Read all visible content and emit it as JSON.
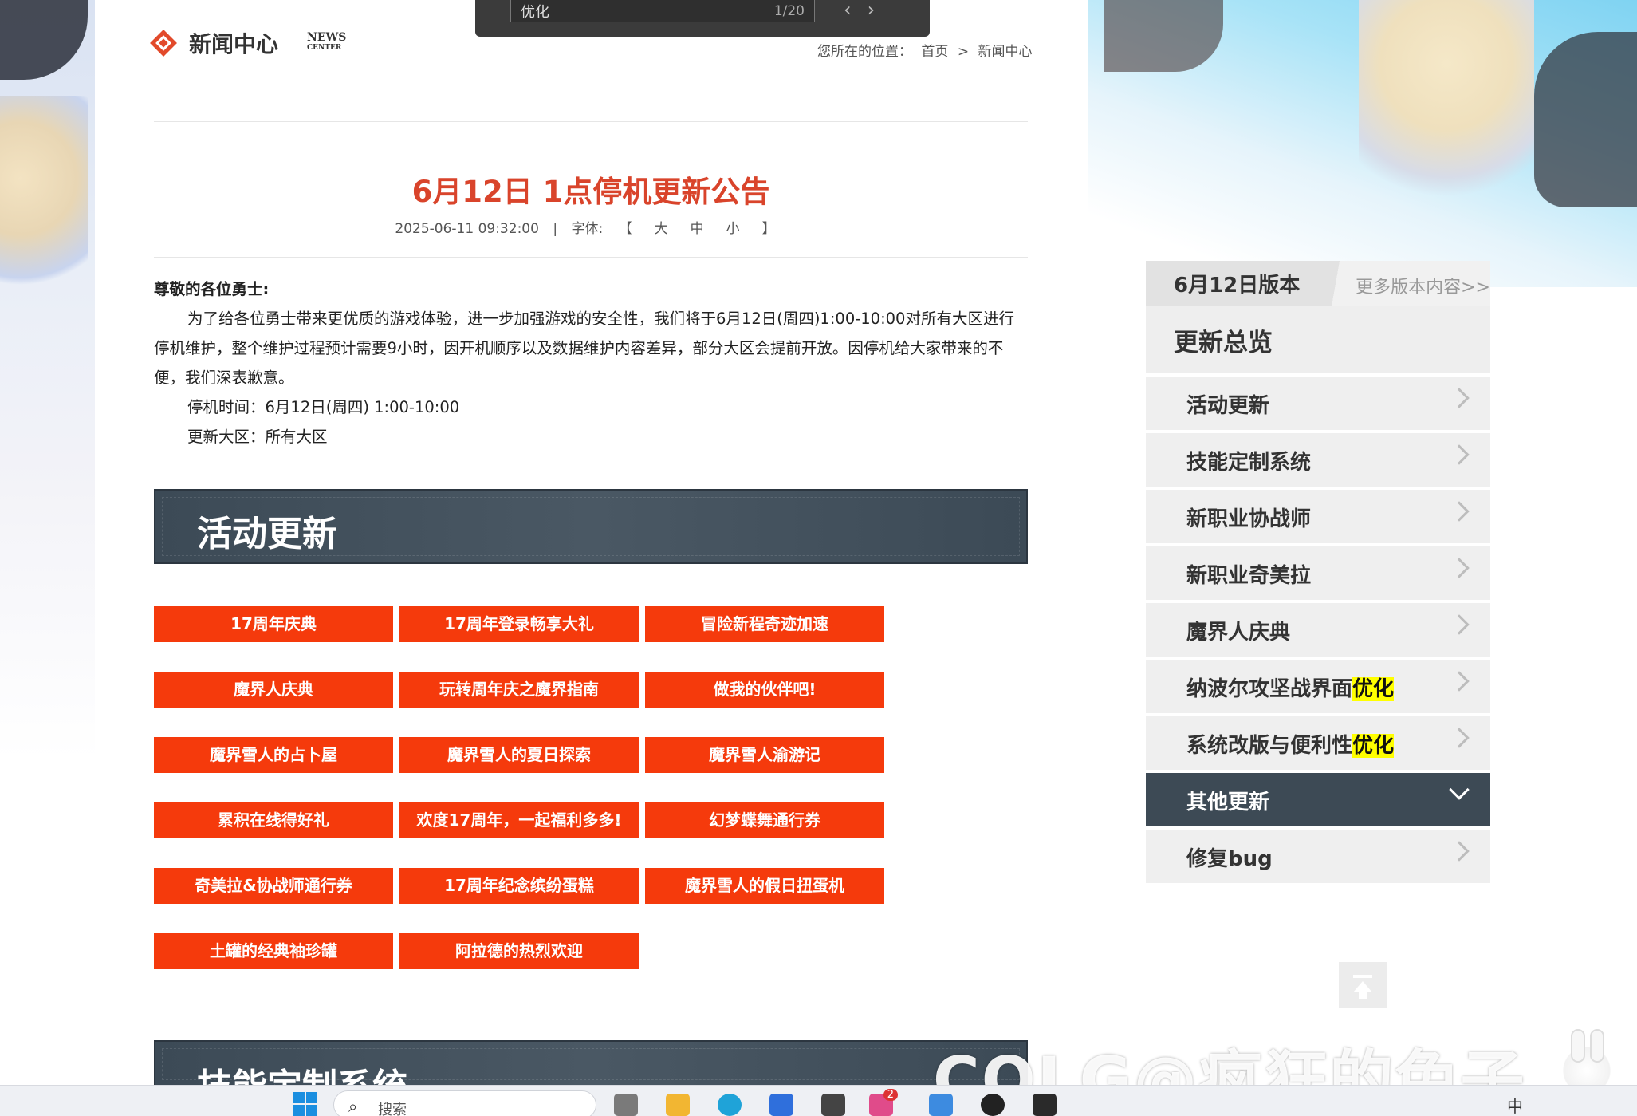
{
  "findbar": {
    "query": "优化",
    "count": "1/20",
    "prev": "‹",
    "next": "›"
  },
  "header": {
    "logo_text": "新闻中心",
    "logo_en_line1": "NEWS",
    "logo_en_line2": "CENTER",
    "breadcrumb_prefix": "您所在的位置：",
    "breadcrumb_home": "首页",
    "breadcrumb_sep": ">",
    "breadcrumb_current": "新闻中心"
  },
  "article": {
    "title": "6月12日 1点停机更新公告",
    "datetime": "2025-06-11 09:32:00",
    "meta_sep": "|",
    "font_label": "字体:",
    "font_open": "【",
    "font_large": "大",
    "font_medium": "中",
    "font_small": "小",
    "font_close": "】",
    "greeting": "尊敬的各位勇士:",
    "para1": "为了给各位勇士带来更优质的游戏体验，进一步加强游戏的安全性，我们将于6月12日(周四)1:00-10:00对所有大区进行停机维护，整个维护过程预计需要9小时，因开机顺序以及数据维护内容差异，部分大区会提前开放。因停机给大家带来的不便，我们深表歉意。",
    "downtime": "停机时间：6月12日(周四) 1:00-10:00",
    "regions": "更新大区：所有大区"
  },
  "sections": {
    "activity_title": "活动更新",
    "skill_title": "技能定制系统"
  },
  "activity_buttons": [
    "17周年庆典",
    "17周年登录畅享大礼",
    "冒险新程奇迹加速",
    "魔界人庆典",
    "玩转周年庆之魔界指南",
    "做我的伙伴吧!",
    "魔界雪人的占卜屋",
    "魔界雪人的夏日探索",
    "魔界雪人渝游记",
    "累积在线得好礼",
    "欢度17周年，一起福利多多!",
    "幻梦蝶舞通行券",
    "奇美拉&协战师通行券",
    "17周年纪念缤纷蛋糕",
    "魔界雪人的假日扭蛋机",
    "土罐的经典袖珍罐",
    "阿拉德的热烈欢迎"
  ],
  "sidebar": {
    "version": "6月12日版本",
    "more": "更多版本内容>>",
    "overview": "更新总览",
    "items": [
      {
        "label": "活动更新",
        "highlight": ""
      },
      {
        "label": "技能定制系统",
        "highlight": ""
      },
      {
        "label": "新职业协战师",
        "highlight": ""
      },
      {
        "label": "新职业奇美拉",
        "highlight": ""
      },
      {
        "label": "魔界人庆典",
        "highlight": ""
      },
      {
        "label": "纳波尔攻坚战界面",
        "highlight": "优化"
      },
      {
        "label": "系统改版与便利性",
        "highlight": "优化"
      },
      {
        "label": "其他更新",
        "highlight": ""
      },
      {
        "label": "修复bug",
        "highlight": ""
      }
    ],
    "active_index": 7
  },
  "watermark": "COLG@疯狂的兔子",
  "taskbar": {
    "search_placeholder": "搜索",
    "badge": "2",
    "ime": "中"
  },
  "colors": {
    "accent_red": "#d9442b",
    "button_red": "#f53a0c",
    "banner_dark": "#3c4a56",
    "highlight_yellow": "#ffff00"
  }
}
